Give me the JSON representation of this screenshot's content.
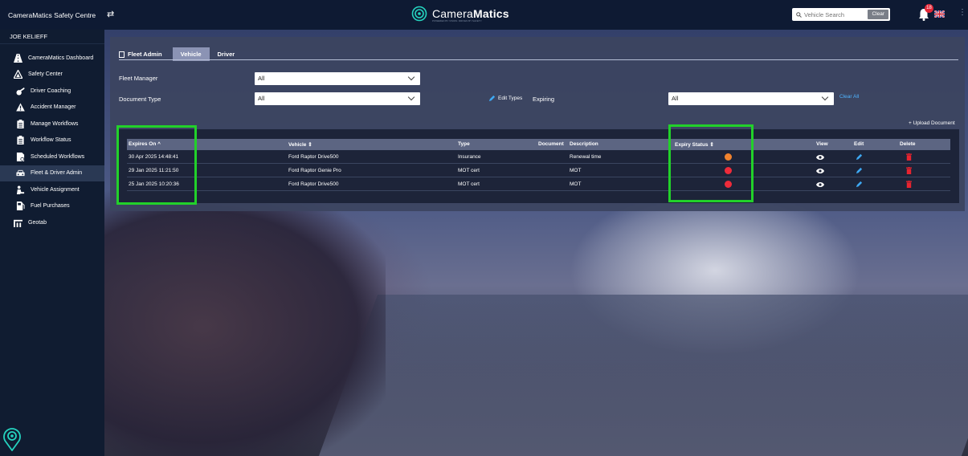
{
  "app": {
    "title": "CameraMatics Safety Centre",
    "logo_text_light": "Camera",
    "logo_text_bold": "Matics",
    "logo_subtext": "POWERED BY VISION. DRIVEN BY SAFETY."
  },
  "header": {
    "search_placeholder": "Vehicle Search",
    "clear_label": "Clear",
    "notification_count": "18"
  },
  "sidebar": {
    "user": "JOE KELIEFF",
    "items": [
      {
        "label": "CameraMatics Dashboard",
        "icon": "road-icon",
        "level": "top"
      },
      {
        "label": "Safety Center",
        "icon": "safety-triangle-icon",
        "level": "top"
      },
      {
        "label": "Driver Coaching",
        "icon": "whistle-icon",
        "level": "sub"
      },
      {
        "label": "Accident Manager",
        "icon": "warning-icon",
        "level": "sub"
      },
      {
        "label": "Manage Workflows",
        "icon": "clipboard-icon",
        "level": "sub"
      },
      {
        "label": "Workflow Status",
        "icon": "clipboard-list-icon",
        "level": "sub"
      },
      {
        "label": "Scheduled Workflows",
        "icon": "calendar-doc-icon",
        "level": "sub"
      },
      {
        "label": "Fleet & Driver Admin",
        "icon": "car-icon",
        "level": "sub",
        "active": true
      },
      {
        "label": "Vehicle Assignment",
        "icon": "user-assign-icon",
        "level": "sub"
      },
      {
        "label": "Fuel Purchases",
        "icon": "fuel-icon",
        "level": "sub"
      },
      {
        "label": "Geotab",
        "icon": "geotab-icon",
        "level": "top"
      }
    ]
  },
  "panel": {
    "title": "Fleet Admin",
    "tabs": [
      "Vehicle",
      "Driver"
    ],
    "active_tab": "Vehicle",
    "fleet_manager_label": "Fleet Manager",
    "fleet_manager_value": "All",
    "document_type_label": "Document Type",
    "document_type_value": "All",
    "edit_types_label": "Edit Types",
    "expiring_label": "Expiring",
    "expiring_value": "All",
    "clear_all_label": "Clear All",
    "upload_label": "+ Upload Document"
  },
  "table": {
    "columns": [
      "Expires On ^",
      "Vehicle ⇕",
      "Type",
      "Document",
      "Description",
      "Expiry Status ⇕",
      "View",
      "Edit",
      "Delete"
    ],
    "rows": [
      {
        "expires_on": "30 Apr 2025 14:48:41",
        "vehicle": "Ford Raptor Drive500",
        "type": "Insurance",
        "description": "Renewal time",
        "status_color": "#f0822e"
      },
      {
        "expires_on": "29 Jan 2025 11:21:50",
        "vehicle": "Ford Raptor Genie Pro",
        "type": "MOT cert",
        "description": "MOT",
        "status_color": "#ee2b3a"
      },
      {
        "expires_on": "25 Jan 2025 10:20:36",
        "vehicle": "Ford Raptor Drive500",
        "type": "MOT cert",
        "description": "MOT",
        "status_color": "#ee2b3a"
      }
    ]
  },
  "colors": {
    "highlight": "#22d12a",
    "link": "#4fb3ff",
    "delete": "#e8232f",
    "edit": "#3ea8f2"
  }
}
